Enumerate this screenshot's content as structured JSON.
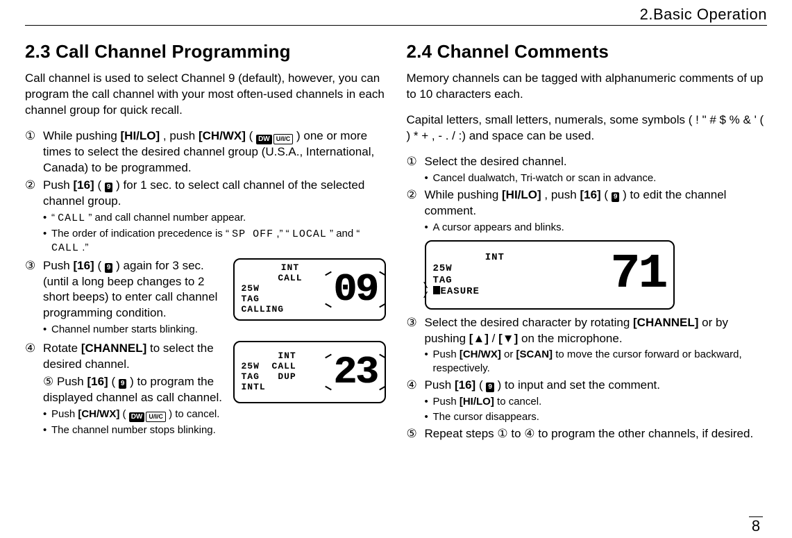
{
  "chapter": "2.Basic Operation",
  "page_number": "8",
  "left": {
    "heading": "2.3 Call Channel Programming",
    "lead": "Call channel is used to select Channel 9 (default), however, you can program the call channel with your most often-used channels in each channel group for quick recall.",
    "step1_a": "While pushing ",
    "step1_key1": "[HI/LO]",
    "step1_b": ", push ",
    "step1_key2": "[CH/WX]",
    "step1_c": "(",
    "step1_icon_dw": "DW",
    "step1_icon_uic": "U/I/C",
    "step1_d": ") one or more times to select the desired channel group (U.S.A., International, Canada) to be programmed.",
    "step2_a": "Push ",
    "step2_key": "[16]",
    "step2_b": "(",
    "step2_icon9": "9",
    "step2_c": ") for 1 sec. to select call channel of the selected channel group.",
    "step2_sub1_a": "“",
    "step2_sub1_mono": "CALL",
    "step2_sub1_b": "” and call channel number appear.",
    "step2_sub2_a": "The order of indication precedence is “",
    "step2_sub2_mono1": "SP OFF",
    "step2_sub2_b": ",” “",
    "step2_sub2_mono2": "LOCAL",
    "step2_sub2_c": "” and “",
    "step2_sub2_mono3": "CALL",
    "step2_sub2_d": ".”",
    "step3_a": "Push ",
    "step3_key": "[16]",
    "step3_b": "(",
    "step3_icon9": "9",
    "step3_c": ") again for 3 sec. (until a long beep changes to 2 short beeps) to enter call channel programming condition.",
    "step3_sub1": "Channel number starts blinking.",
    "lcd1": {
      "top": "INT",
      "line2": "CALL",
      "line3": "25W",
      "line4": "TAG",
      "line5": "CALLING",
      "big": "09"
    },
    "step4_a": "Rotate ",
    "step4_key": "[CHANNEL]",
    "step4_b": " to select the desired channel.",
    "step5_a": "Push ",
    "step5_key": "[16]",
    "step5_b": "(",
    "step5_icon9": "9",
    "step5_c": ") to program the displayed channel as call channel.",
    "lcd2": {
      "top": "INT",
      "line2": "CALL",
      "line3": "25W",
      "line4": "TAG",
      "line5": "INTL",
      "line_dup": "DUP",
      "big": "23"
    },
    "step5_sub1_a": "Push ",
    "step5_sub1_key": "[CH/WX]",
    "step5_sub1_b": "(",
    "step5_sub1_dw": "DW",
    "step5_sub1_uic": "U/I/C",
    "step5_sub1_c": ") to cancel.",
    "step5_sub2": "The channel number stops blinking."
  },
  "right": {
    "heading": "2.4 Channel Comments",
    "lead": "Memory channels can be tagged with alphanumeric comments of up to 10 characters each.",
    "para2_a": "Capital letters, small letters, numerals, some symbols ( ! \" # $ % & ' ( ) * + , - . / :) and space can be used.",
    "step1": "Select the desired channel.",
    "step1_sub1": "Cancel dualwatch, Tri-watch or scan in advance.",
    "step2_a": "While pushing ",
    "step2_key1": "[HI/LO]",
    "step2_b": ", push ",
    "step2_key2": "[16]",
    "step2_c": "(",
    "step2_icon9": "9",
    "step2_d": ") to edit the channel comment.",
    "step2_sub1": "A cursor appears and blinks.",
    "lcd": {
      "top": "INT",
      "line1": "25W",
      "line2": "TAG",
      "line3": "EASURE",
      "big": "71"
    },
    "step3_a": "Select the desired character by rotating ",
    "step3_key1": "[CHANNEL]",
    "step3_b": " or by pushing ",
    "step3_key2": "[▲]",
    "step3_c": "/",
    "step3_key3": "[▼]",
    "step3_d": " on the microphone.",
    "step3_sub1_a": "Push ",
    "step3_sub1_key1": "[CH/WX]",
    "step3_sub1_b": " or ",
    "step3_sub1_key2": "[SCAN]",
    "step3_sub1_c": " to move the cursor forward or backward, respectively.",
    "step4_a": "Push ",
    "step4_key": "[16]",
    "step4_b": "(",
    "step4_icon9": "9",
    "step4_c": ") to input and set the comment.",
    "step4_sub1_a": "Push ",
    "step4_sub1_key": "[HI/LO]",
    "step4_sub1_b": " to cancel.",
    "step4_sub2": "The cursor disappears.",
    "step5": "Repeat steps ① to ④ to program the other channels, if desired."
  }
}
